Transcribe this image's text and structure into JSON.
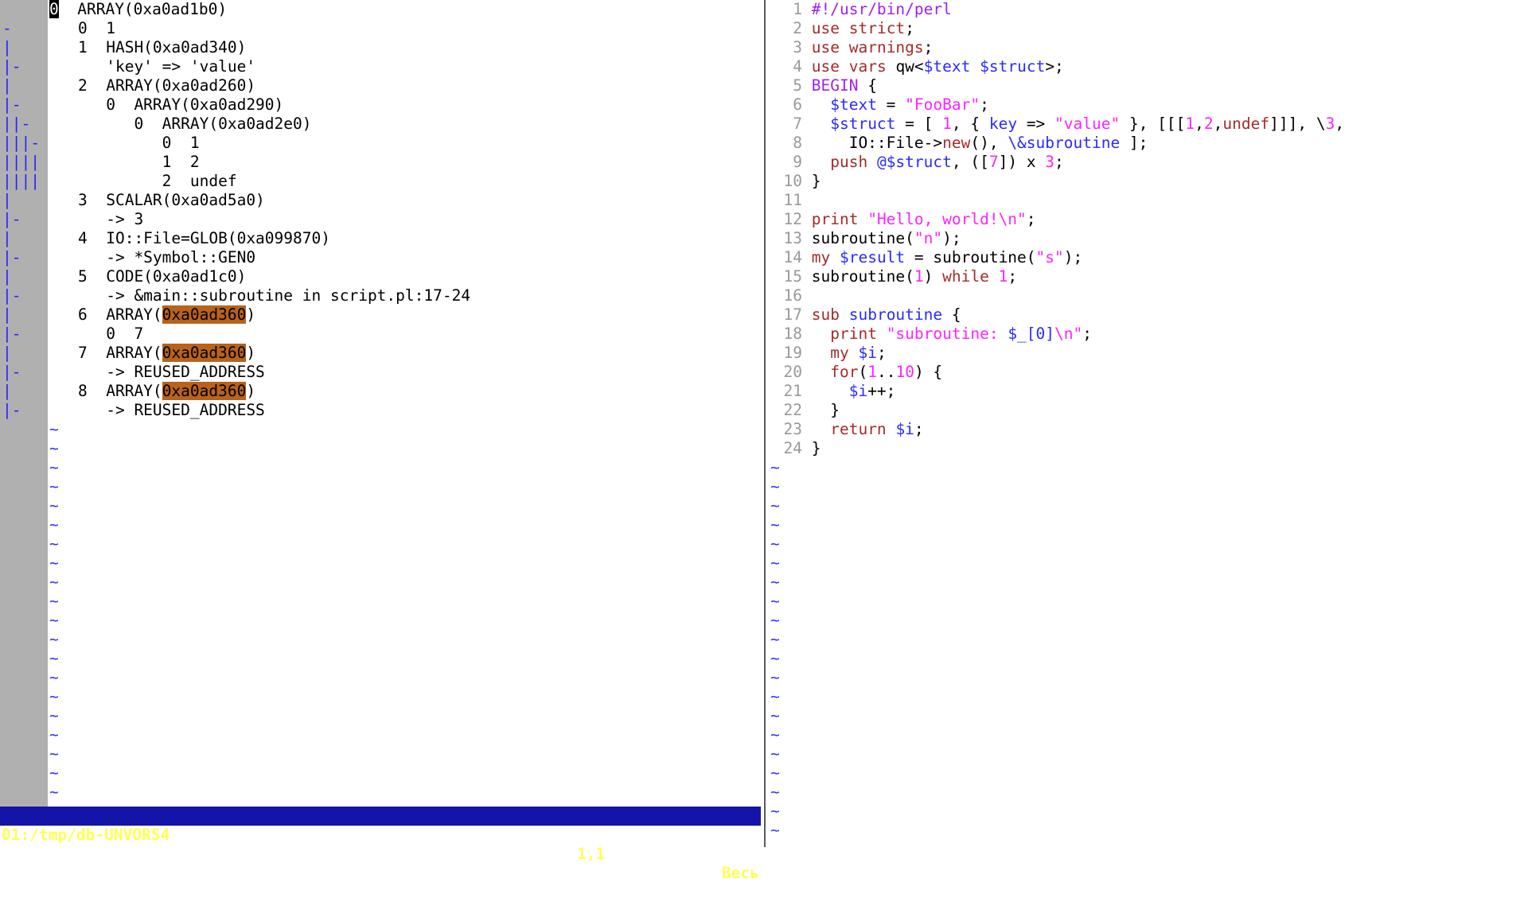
{
  "left": {
    "cursor_char": "0",
    "lines": [
      "ARRAY(0xa0ad1b0)",
      "0  1",
      "1  HASH(0xa0ad340)",
      "   'key' => 'value'",
      "2  ARRAY(0xa0ad260)",
      "   0  ARRAY(0xa0ad290)",
      "      0  ARRAY(0xa0ad2e0)",
      "         0  1",
      "         1  2",
      "         2  undef",
      "3  SCALAR(0xa0ad5a0)",
      "   -> 3",
      "4  IO::File=GLOB(0xa099870)",
      "   -> *Symbol::GEN0",
      "5  CODE(0xa0ad1c0)",
      "   -> &main::subroutine in script.pl:17-24",
      "6  ARRAY(",
      "   0  7",
      "7  ARRAY(",
      "   -> REUSED_ADDRESS",
      "8  ARRAY(",
      "   -> REUSED_ADDRESS"
    ],
    "reused_address": "0xa0ad360",
    "close_paren": ")",
    "fold_marks": [
      "-",
      "|",
      "|-",
      "|",
      "|-",
      "||-",
      "|||-",
      "||||",
      "||||",
      "|",
      "|-",
      "|",
      "|-",
      "|",
      "|-",
      "|",
      "|-",
      "|",
      "|-",
      "|",
      "|-"
    ]
  },
  "status": {
    "file": "01:/tmp/db-UNVORS4",
    "position": "1,1",
    "scroll": "Весь"
  },
  "tilde": "~",
  "code": {
    "line_numbers": [
      "1",
      "2",
      "3",
      "4",
      "5",
      "6",
      "7",
      "8",
      "9",
      "10",
      "11",
      "12",
      "13",
      "14",
      "15",
      "16",
      "17",
      "18",
      "19",
      "20",
      "21",
      "22",
      "23",
      "24"
    ]
  },
  "colors": {
    "status_bg": "#1414a8",
    "status_fg": "#ffff55",
    "highlight": "#b8621b",
    "fold_gutter": "#b0b0b0"
  }
}
